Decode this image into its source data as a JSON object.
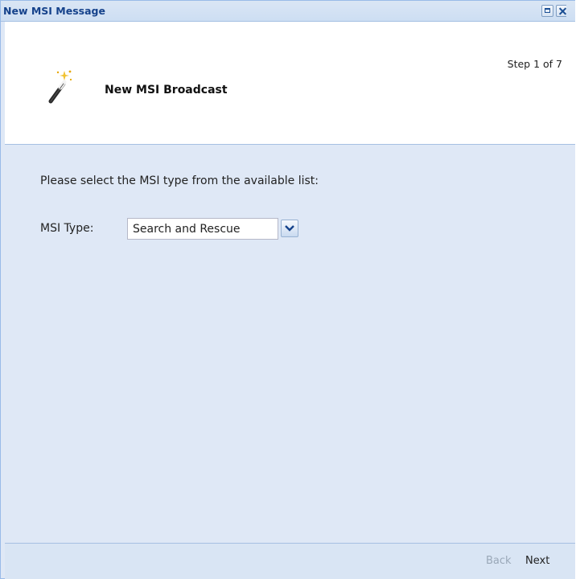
{
  "window": {
    "title": "New MSI Message",
    "tools": [
      "maximize-icon",
      "close-icon"
    ]
  },
  "header": {
    "heading": "New MSI Broadcast",
    "step": "Step 1 of 7",
    "icon": "magic-wand-icon"
  },
  "form": {
    "prompt": "Please select the MSI type from the available list:",
    "type_label": "MSI Type:",
    "type_value": "Search and Rescue"
  },
  "footer": {
    "back_label": "Back",
    "next_label": "Next",
    "back_enabled": false
  },
  "colors": {
    "title_text": "#15428b",
    "panel_bg": "#dfe8f6",
    "border": "#99bbe8"
  }
}
